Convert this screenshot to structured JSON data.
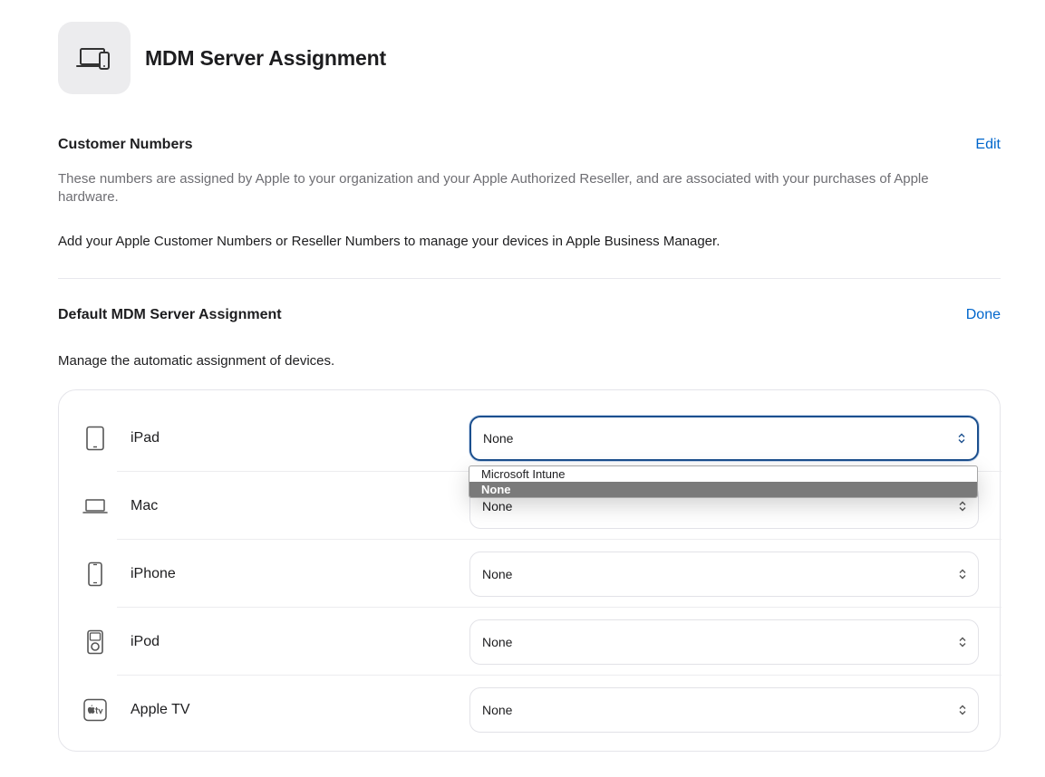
{
  "header": {
    "title": "MDM Server Assignment",
    "icon": "laptop-phone-icon"
  },
  "customer_numbers": {
    "title": "Customer Numbers",
    "edit_label": "Edit",
    "description": "These numbers are assigned by Apple to your organization and your Apple Authorized Reseller, and are associated with your purchases of Apple hardware.",
    "note": "Add your Apple Customer Numbers or Reseller Numbers to manage your devices in Apple Business Manager."
  },
  "default_assignment": {
    "title": "Default MDM Server Assignment",
    "done_label": "Done",
    "description": "Manage the automatic assignment of devices.",
    "rows": [
      {
        "device": "iPad",
        "icon": "ipad-icon",
        "value": "None"
      },
      {
        "device": "Mac",
        "icon": "laptop-icon",
        "value": "None"
      },
      {
        "device": "iPhone",
        "icon": "iphone-icon",
        "value": "None"
      },
      {
        "device": "iPod",
        "icon": "ipod-icon",
        "value": "None"
      },
      {
        "device": "Apple TV",
        "icon": "apple-tv-icon",
        "value": "None"
      }
    ]
  },
  "dropdown": {
    "options": [
      "Microsoft Intune",
      "None"
    ],
    "selected": "None"
  },
  "colors": {
    "accent": "#0066cc",
    "focus_border": "#1b4f8e",
    "selected_option": "#7a7a7a"
  }
}
